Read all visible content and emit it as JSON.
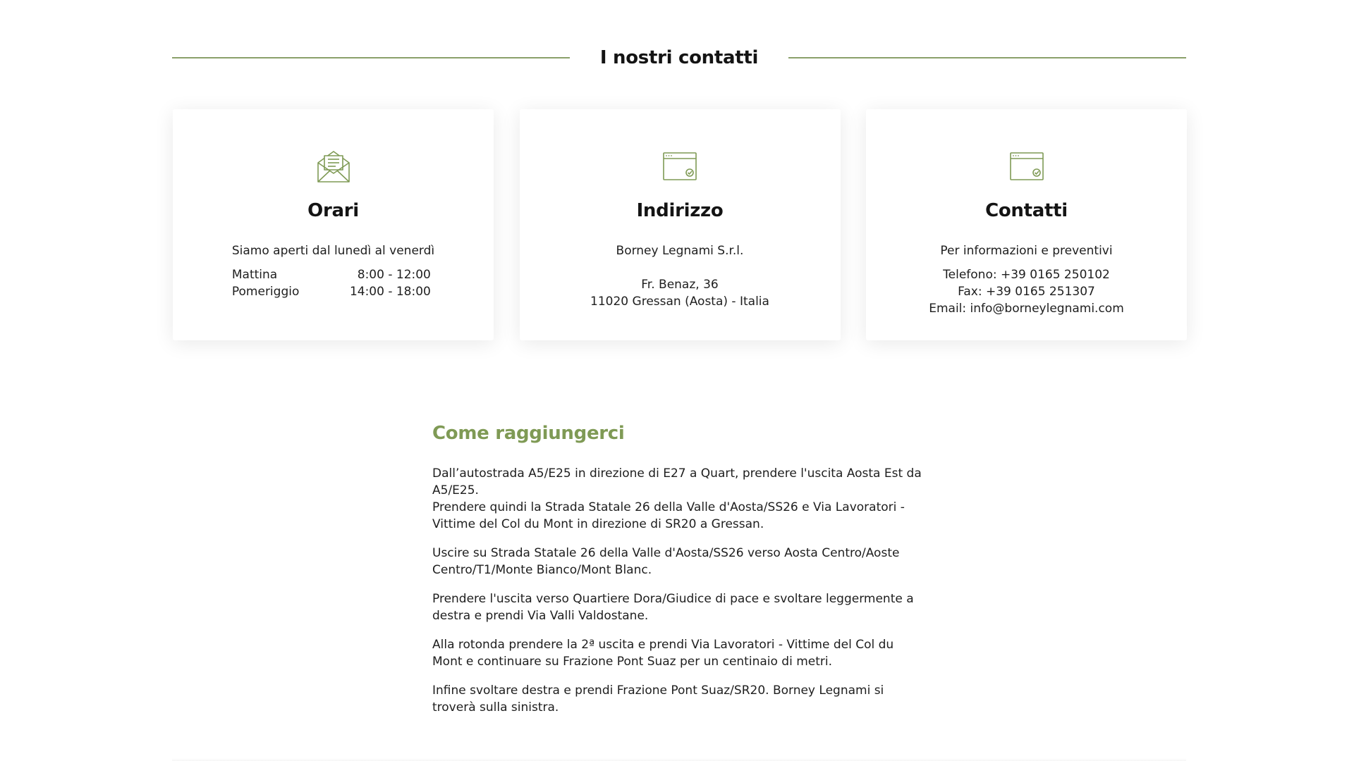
{
  "section": {
    "title": "I nostri contatti"
  },
  "colors": {
    "accent": "#7f9a55",
    "rule": "#8aa06a"
  },
  "cards": {
    "orari": {
      "icon": "envelope-open-icon",
      "title": "Orari",
      "intro": "Siamo aperti dal lunedì al venerdì",
      "rows": [
        {
          "label": "Mattina",
          "time": "8:00 - 12:00"
        },
        {
          "label": "Pomeriggio",
          "time": "14:00 - 18:00"
        }
      ]
    },
    "indirizzo": {
      "icon": "browser-window-check-icon",
      "title": "Indirizzo",
      "company": "Borney Legnami S.r.l.",
      "street": "Fr. Benaz, 36",
      "city": "11020 Gressan (Aosta) - Italia"
    },
    "contatti": {
      "icon": "browser-window-check-icon",
      "title": "Contatti",
      "intro": "Per informazioni e preventivi",
      "phone": "Telefono: +39 0165 250102",
      "fax": "Fax: +39 0165 251307",
      "email": "Email: info@borneylegnami.com"
    }
  },
  "directions": {
    "title": "Come raggiungerci",
    "paragraphs": [
      "Dall’autostrada A5/E25 in direzione di E27 a Quart, prendere l'uscita Aosta Est da A5/E25.",
      "Prendere quindi la Strada Statale 26 della Valle d'Aosta/SS26 e Via Lavoratori - Vittime del Col du Mont in direzione di SR20 a Gressan.",
      "Uscire su Strada Statale 26 della Valle d'Aosta/SS26 verso Aosta Centro/Aoste Centro/T1/Monte Bianco/Mont Blanc.",
      "Prendere l'uscita verso Quartiere Dora/Giudice di pace e svoltare leggermente a destra e prendi Via Valli Valdostane.",
      "Alla rotonda prendere la 2ª uscita e prendi Via Lavoratori - Vittime del Col du Mont e continuare su Frazione Pont Suaz per un centinaio di metri.",
      "Infine svoltare destra e prendi Frazione Pont Suaz/SR20. Borney Legnami si troverà sulla sinistra."
    ]
  }
}
